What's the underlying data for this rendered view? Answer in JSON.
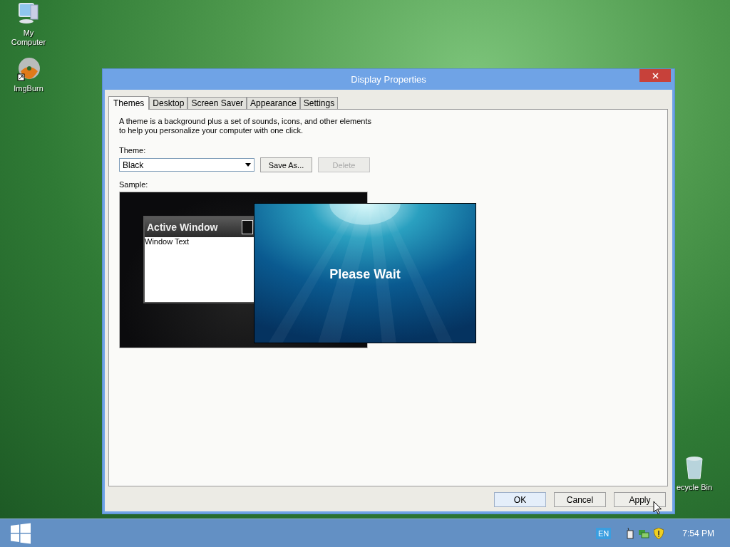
{
  "desktop_icons": [
    {
      "kind": "computer",
      "label": "My Computer"
    },
    {
      "kind": "disc",
      "label": "ImgBurn"
    },
    {
      "kind": "recycle",
      "label": "ecycle Bin"
    }
  ],
  "window": {
    "title": "Display Properties",
    "tabs": [
      {
        "label": "Themes",
        "selected": true
      },
      {
        "label": "Desktop",
        "selected": false
      },
      {
        "label": "Screen Saver",
        "selected": false
      },
      {
        "label": "Appearance",
        "selected": false
      },
      {
        "label": "Settings",
        "selected": false
      }
    ],
    "description": "A theme is a background plus a set of sounds, icons, and other elements to help you personalize your computer with one click.",
    "theme_label": "Theme:",
    "theme_value": "Black",
    "theme_buttons": [
      {
        "label": "Save As...",
        "disabled": false
      },
      {
        "label": "Delete",
        "disabled": true
      }
    ],
    "sample_label": "Sample:",
    "sample": {
      "active_window_title": "Active Window",
      "window_text": "Window Text"
    },
    "dialog_buttons": [
      {
        "label": "OK",
        "focused": true
      },
      {
        "label": "Cancel",
        "focused": false
      },
      {
        "label": "Apply",
        "focused": false
      }
    ]
  },
  "splash": {
    "text": "Please Wait"
  },
  "taskbar": {
    "language": "EN",
    "clock": "7:54 PM"
  }
}
